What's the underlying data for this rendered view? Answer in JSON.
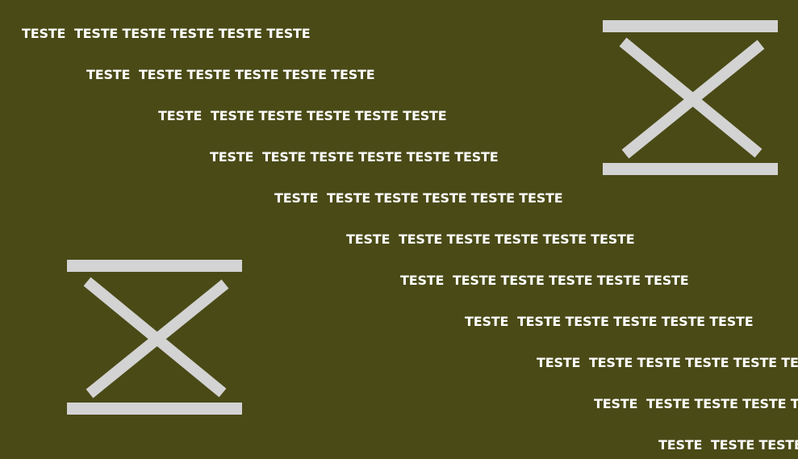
{
  "background_color": "#4a4a17",
  "text_color": "#ffffff",
  "mark_color": "#d3d3d3",
  "text_lines": [
    "TESTE  TESTE TESTE TESTE TESTE TESTE",
    "TESTE  TESTE TESTE TESTE TESTE TESTE",
    "TESTE  TESTE TESTE TESTE TESTE TESTE",
    "TESTE  TESTE TESTE TESTE TESTE TESTE",
    "TESTE  TESTE TESTE TESTE TESTE TESTE",
    "TESTE  TESTE TESTE TESTE TESTE TESTE",
    "TESTE  TESTE TESTE TESTE TESTE TESTE",
    "TESTE  TESTE TESTE TESTE TESTE TESTE",
    "TESTE  TESTE TESTE TESTE TESTE TESTE",
    "TESTE  TESTE TESTE TESTE TESTE TESTE",
    "TESTE  TESTE TESTE TESTE TESTE TESTE"
  ],
  "marks": [
    {
      "icon": "hourglass-x-icon"
    },
    {
      "icon": "hourglass-x-icon"
    }
  ]
}
